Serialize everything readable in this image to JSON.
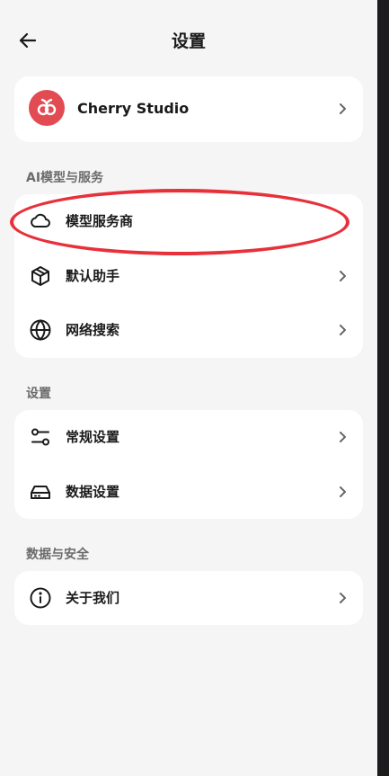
{
  "header": {
    "title": "设置",
    "back_icon": "arrow-left-icon"
  },
  "app_card": {
    "name": "Cherry Studio",
    "logo_icon": "cherry-logo-icon",
    "brand_color": "#e34b53"
  },
  "sections": [
    {
      "title": "AI模型与服务",
      "items": [
        {
          "label": "模型服务商",
          "icon": "cloud-icon"
        },
        {
          "label": "默认助手",
          "icon": "box-icon"
        },
        {
          "label": "网络搜索",
          "icon": "globe-icon"
        }
      ]
    },
    {
      "title": "设置",
      "items": [
        {
          "label": "常规设置",
          "icon": "sliders-icon"
        },
        {
          "label": "数据设置",
          "icon": "hard-drive-icon"
        }
      ]
    },
    {
      "title": "数据与安全",
      "items": [
        {
          "label": "关于我们",
          "icon": "info-icon"
        }
      ]
    }
  ],
  "colors": {
    "background": "#f5f5f5",
    "card": "#ffffff",
    "annotation": "#e8303a"
  }
}
